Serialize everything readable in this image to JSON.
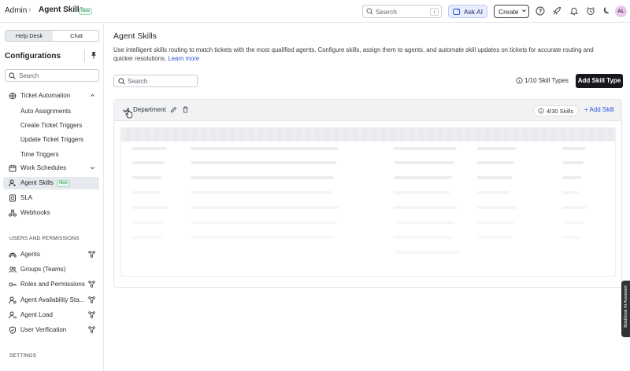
{
  "topbar": {
    "breadcrumb_root": "Admin",
    "breadcrumb_sep": "›",
    "breadcrumb_current": "Agent Skills",
    "new_badge": "New",
    "search_placeholder": "Search",
    "search_shortcut": "/",
    "ask_ai_label": "Ask AI",
    "create_label": "Create",
    "avatar_initials": "AL",
    "icons": [
      "help-icon",
      "rocket-icon",
      "bell-icon",
      "alarm-clock-icon",
      "moon-icon"
    ]
  },
  "sidebar": {
    "segments": [
      "Help Desk",
      "Chat"
    ],
    "active_segment": "Help Desk",
    "title": "Configurations",
    "search_placeholder": "Search",
    "items": [
      {
        "label": "Ticket Automation",
        "expanded": true
      },
      {
        "label": "Auto Assignments"
      },
      {
        "label": "Create Ticket Triggers"
      },
      {
        "label": "Update Ticket Triggers"
      },
      {
        "label": "Time Triggers"
      },
      {
        "label": "Work Schedules"
      },
      {
        "label": "Agent Skills",
        "badge": "New",
        "active": true
      },
      {
        "label": "SLA"
      },
      {
        "label": "Webhooks"
      }
    ],
    "section_users": "USERS AND PERMISSIONS",
    "user_items": [
      {
        "label": "Agents"
      },
      {
        "label": "Groups (Teams)"
      },
      {
        "label": "Roles and Permissions"
      },
      {
        "label": "Agent Availability Sta..."
      },
      {
        "label": "Agent Load"
      },
      {
        "label": "User Verification"
      }
    ],
    "section_settings": "SETTINGS"
  },
  "main": {
    "title": "Agent Skills",
    "description": "Use intelligent skills routing to match tickets with the most qualified agents. Configure skills, assign them to agents, and automate skill updates on tickets for accurate routing and quicker resolutions.",
    "learn_more": "Learn more",
    "search_placeholder": "Search",
    "skill_types_count": "1/10 Skill Types",
    "add_skill_type_label": "Add Skill Type",
    "group": {
      "name": "Department",
      "skills_count": "4/30 Skills",
      "add_skill_label": "+ Add Skill"
    }
  },
  "assistant_tab": "BoldDesk AI Assistant",
  "colors": {
    "accent": "#2f56d6",
    "primary_button": "#16181b",
    "active_nav_bg": "#e6e9ed",
    "new_badge": "#1f8a4c"
  }
}
